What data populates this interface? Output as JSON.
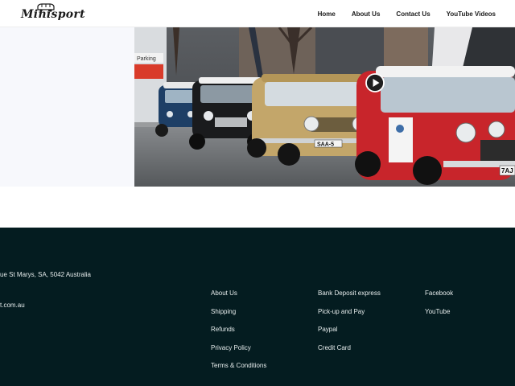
{
  "brand": {
    "logo_text": "Minisport"
  },
  "nav": {
    "items": [
      {
        "label": "Home"
      },
      {
        "label": "About Us"
      },
      {
        "label": "Contact Us"
      },
      {
        "label": "YouTube Videos"
      }
    ]
  },
  "hero": {
    "banner_text": "Parking",
    "plates": [
      "SAA-5",
      "7AJ"
    ],
    "play_icon": "play-icon"
  },
  "footer": {
    "address": "ue St Marys, SA, 5042 Australia",
    "email": "t.com.au",
    "company_links": [
      "About Us",
      "Shipping",
      "Refunds",
      "Privacy Policy",
      "Terms & Conditions"
    ],
    "payment_links": [
      "Bank Deposit express",
      "Pick-up and Pay",
      "Paypal",
      "Credit Card"
    ],
    "social_links": [
      "Facebook",
      "YouTube"
    ]
  },
  "colors": {
    "footer_bg": "#041c20",
    "car_red": "#c8252b",
    "car_gold": "#c3a66a",
    "car_blue": "#1e3f66"
  }
}
